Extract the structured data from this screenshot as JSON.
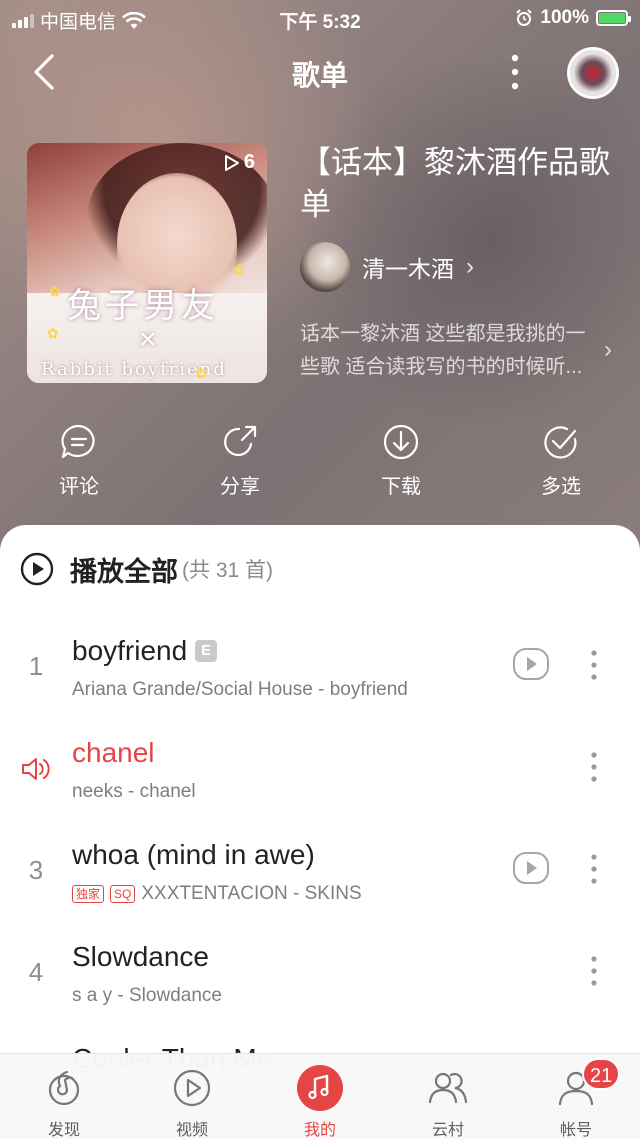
{
  "status_bar": {
    "carrier": "中国电信",
    "time": "下午 5:32",
    "battery": "100%"
  },
  "nav": {
    "title": "歌单"
  },
  "playlist": {
    "cover": {
      "play_count": "6",
      "title_art": "兔子男友",
      "x_mark": "×",
      "subtitle_art": "Rabbit boyfriend"
    },
    "title": "【话本】黎沐酒作品歌单",
    "creator": "清一木酒",
    "description": "话本一黎沐酒 这些都是我挑的一些歌 适合读我写的书的时候听..."
  },
  "actions": [
    {
      "label": "评论",
      "icon": "comment-icon"
    },
    {
      "label": "分享",
      "icon": "share-icon"
    },
    {
      "label": "下载",
      "icon": "download-icon"
    },
    {
      "label": "多选",
      "icon": "multiselect-icon"
    }
  ],
  "play_all": {
    "label": "播放全部",
    "count": "(共 31 首)"
  },
  "songs": [
    {
      "index": "1",
      "title": "boyfriend",
      "badge": "E",
      "meta": "Ariana Grande/Social House - boyfriend",
      "has_mv": true,
      "playing": false
    },
    {
      "index": "",
      "title": "chanel",
      "meta": "neeks - chanel",
      "has_mv": false,
      "playing": true
    },
    {
      "index": "3",
      "title": "whoa (mind in awe)",
      "tags": [
        "独家",
        "SQ"
      ],
      "meta": "XXXTENTACION - SKINS",
      "has_mv": true,
      "playing": false
    },
    {
      "index": "4",
      "title": "Slowdance",
      "meta": "s a y - Slowdance",
      "has_mv": false,
      "playing": false
    },
    {
      "index": "",
      "title": "Cooler Than Me",
      "meta": "",
      "has_mv": false,
      "playing": false
    }
  ],
  "tabs": [
    {
      "label": "发现",
      "icon": "discover-icon",
      "active": false
    },
    {
      "label": "视频",
      "icon": "video-icon",
      "active": false
    },
    {
      "label": "我的",
      "icon": "music-icon",
      "active": true
    },
    {
      "label": "云村",
      "icon": "community-icon",
      "active": false
    },
    {
      "label": "帐号",
      "icon": "account-icon",
      "active": false,
      "badge": "21"
    }
  ],
  "colors": {
    "accent": "#e64545",
    "hero_bg": "#8e7f7e",
    "text_primary": "#222222",
    "text_secondary": "#7e7e7e"
  }
}
